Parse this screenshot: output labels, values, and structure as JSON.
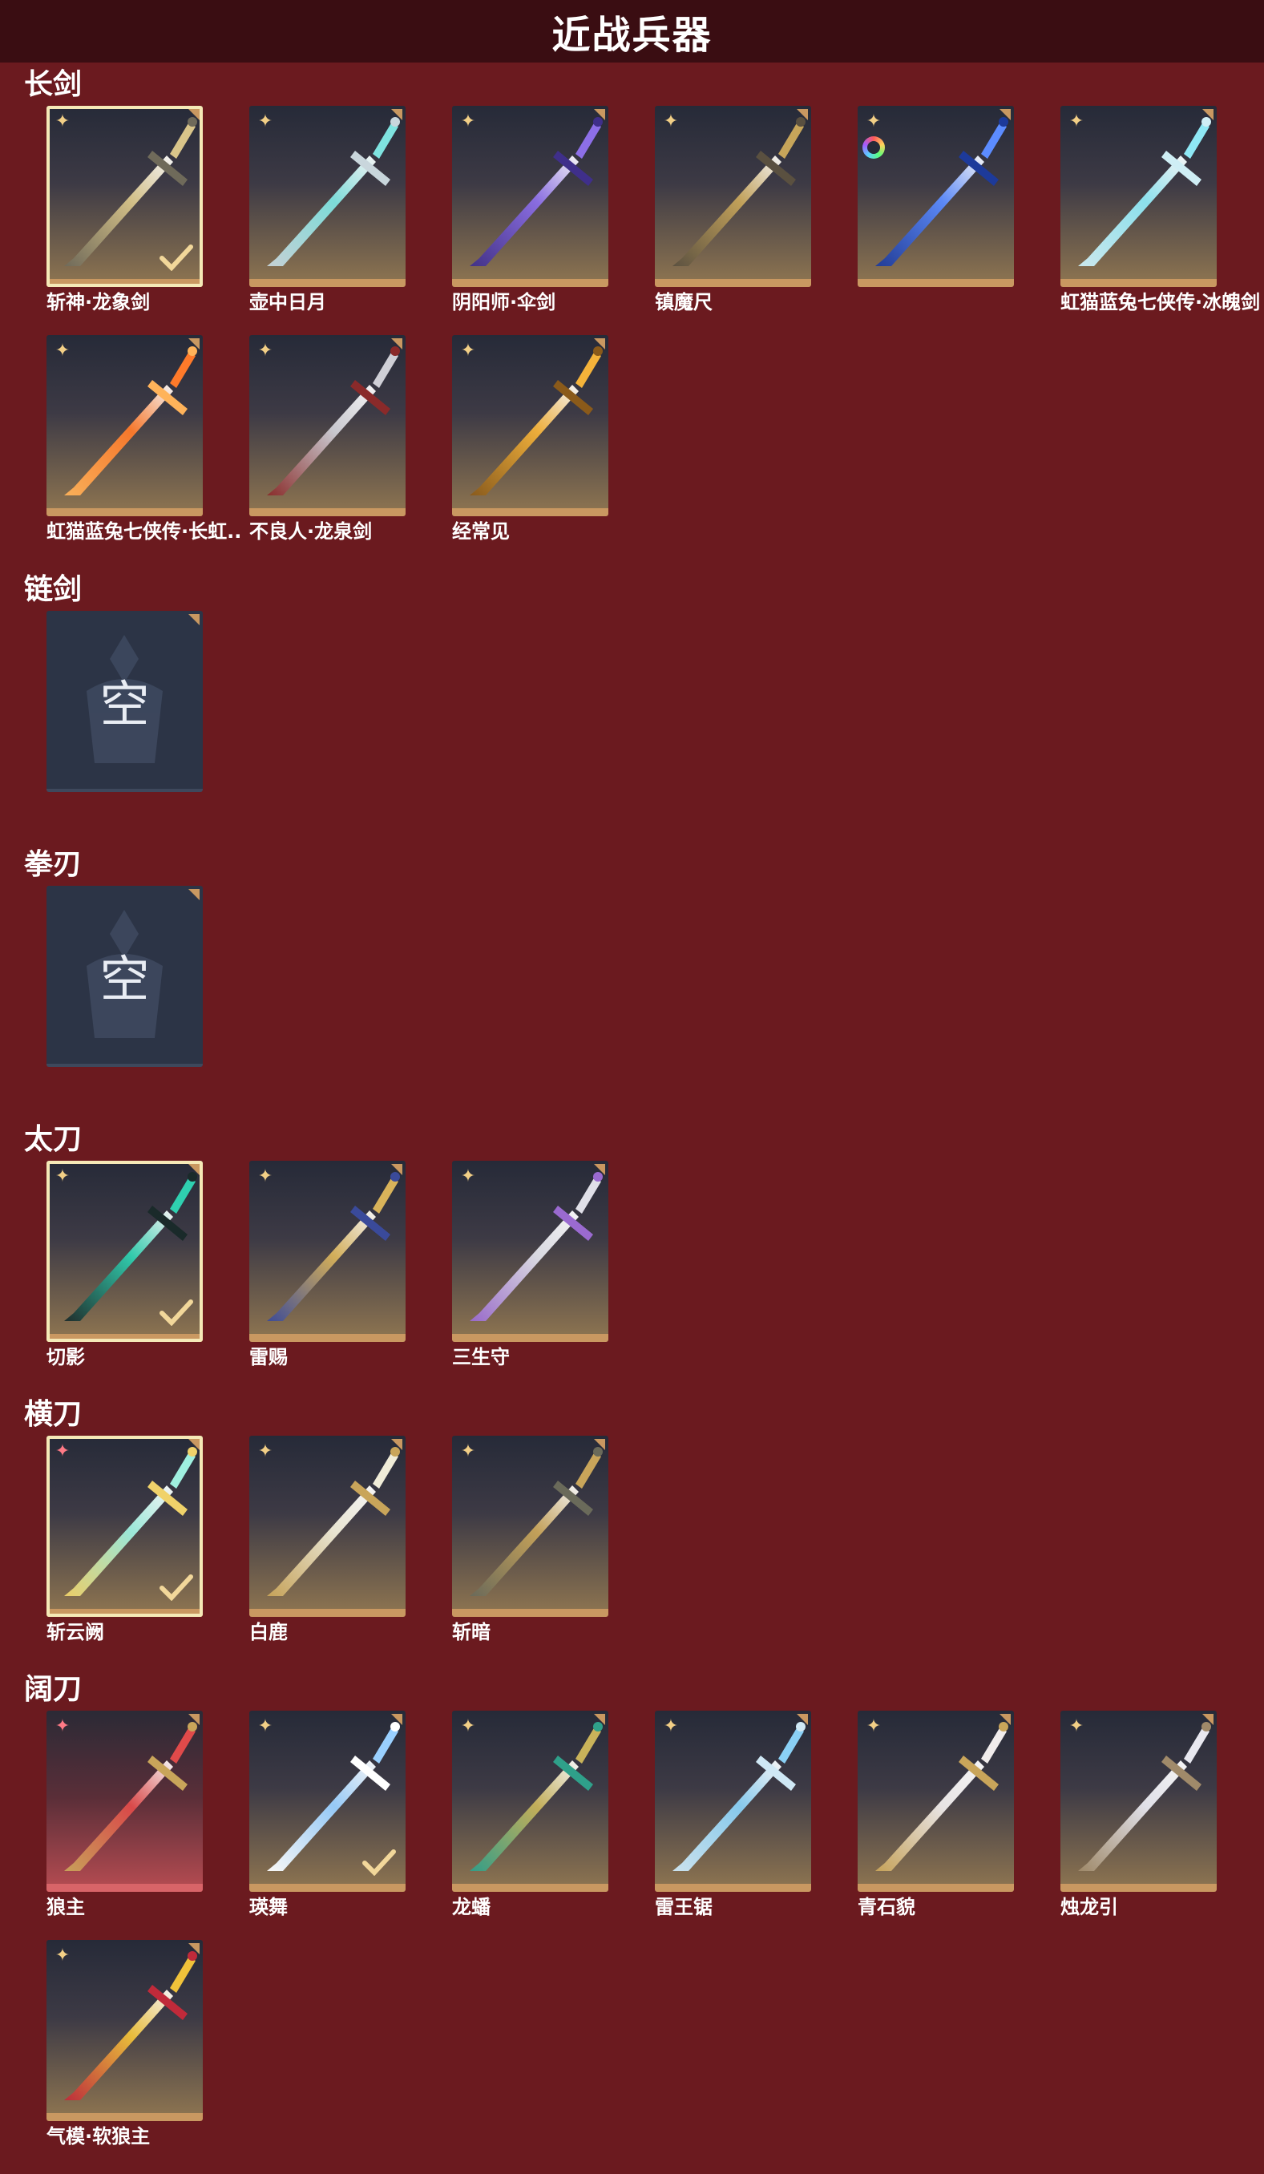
{
  "header": {
    "title": "近战兵器"
  },
  "colors": {
    "background": "#6b1a1f",
    "header": "#3a0d12",
    "card_accent": "#c99861",
    "selected_border": "#f5e9b7"
  },
  "sections": [
    {
      "title": "长剑",
      "items": [
        {
          "name": "斩神·龙象剑",
          "rarity": "gold-star",
          "selected": true,
          "equipped": true,
          "icon": "dragon-sword-icon"
        },
        {
          "name": "壶中日月",
          "rarity": "gold-star",
          "icon": "jade-sword-icon"
        },
        {
          "name": "阴阳师·伞剑",
          "rarity": "gold-star",
          "icon": "umbrella-sword-icon"
        },
        {
          "name": "镇魔尺",
          "rarity": "gold-star",
          "icon": "demon-ruler-icon"
        },
        {
          "name": "",
          "rarity": "rainbow-ring",
          "icon": "blue-blade-icon"
        },
        {
          "name": "虹猫蓝兔七侠传·冰魄剑",
          "rarity": "gold-star",
          "icon": "ice-sword-icon"
        },
        {
          "name": "虹猫蓝兔七侠传·长虹..",
          "rarity": "gold-star",
          "icon": "rainbow-sword-icon"
        },
        {
          "name": "不良人·龙泉剑",
          "rarity": "gold-star",
          "icon": "longquan-sword-icon"
        },
        {
          "name": "经常见",
          "rarity": "gold-star",
          "icon": "golden-sword-icon"
        }
      ]
    },
    {
      "title": "链剑",
      "items": [
        {
          "name": "",
          "empty": true,
          "empty_label": "空"
        }
      ]
    },
    {
      "title": "拳刃",
      "items": [
        {
          "name": "",
          "empty": true,
          "empty_label": "空"
        }
      ]
    },
    {
      "title": "太刀",
      "items": [
        {
          "name": "切影",
          "rarity": "gold-star",
          "selected": true,
          "equipped": true,
          "icon": "shadow-katana-icon"
        },
        {
          "name": "雷赐",
          "rarity": "gold-star",
          "icon": "thunder-katana-icon"
        },
        {
          "name": "三生守",
          "rarity": "gold-star",
          "icon": "three-lives-katana-icon"
        }
      ]
    },
    {
      "title": "横刀",
      "items": [
        {
          "name": "斩云阙",
          "rarity": "pink-star",
          "selected": true,
          "equipped": true,
          "icon": "cloud-blade-icon"
        },
        {
          "name": "白鹿",
          "rarity": "gold-star",
          "icon": "white-deer-blade-icon"
        },
        {
          "name": "斩暗",
          "rarity": "gold-star",
          "icon": "dark-blade-icon"
        }
      ]
    },
    {
      "title": "阔刀",
      "items": [
        {
          "name": "狼主",
          "rarity": "pink-star",
          "red": true,
          "icon": "wolf-lord-broadsword-icon"
        },
        {
          "name": "瑛舞",
          "rarity": "gold-star",
          "equipped": true,
          "icon": "crystal-dance-broadsword-icon"
        },
        {
          "name": "龙蟠",
          "rarity": "gold-star",
          "icon": "coiled-dragon-broadsword-icon"
        },
        {
          "name": "雷王锯",
          "rarity": "gold-star",
          "icon": "thunder-saw-broadsword-icon"
        },
        {
          "name": "青石貌",
          "rarity": "gold-star",
          "icon": "bluestone-broadsword-icon"
        },
        {
          "name": "烛龙引",
          "rarity": "gold-star",
          "icon": "candle-dragon-broadsword-icon"
        },
        {
          "name": "气模·软狼主",
          "rarity": "gold-star",
          "icon": "soft-wolf-broadsword-icon"
        }
      ]
    }
  ]
}
